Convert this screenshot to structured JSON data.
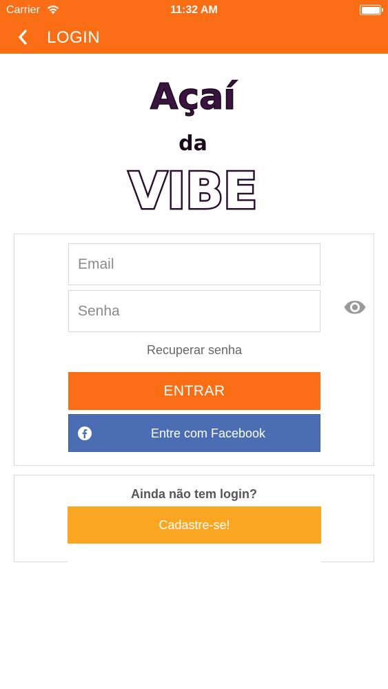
{
  "status_bar": {
    "carrier": "Carrier",
    "time": "11:32 AM",
    "wifi_icon": "wifi-icon",
    "battery_icon": "battery-icon"
  },
  "nav": {
    "back_icon": "chevron-left-icon",
    "title": "LOGIN"
  },
  "logo": {
    "line1": "Açaí",
    "line2": "da",
    "line3": "VIBE"
  },
  "login": {
    "email_placeholder": "Email",
    "email_value": "",
    "password_placeholder": "Senha",
    "password_value": "",
    "show_password_icon": "eye-icon",
    "recover_label": "Recuperar senha",
    "submit_label": "ENTRAR",
    "facebook_label": "Entre com Facebook",
    "facebook_icon": "facebook-icon"
  },
  "signup": {
    "prompt": "Ainda não tem login?",
    "button_label": "Cadastre-se!"
  },
  "colors": {
    "brand_orange": "#f96d15",
    "facebook_blue": "#4a6db4",
    "signup_yellow": "#fba623",
    "logo_purple": "#3a1340"
  }
}
